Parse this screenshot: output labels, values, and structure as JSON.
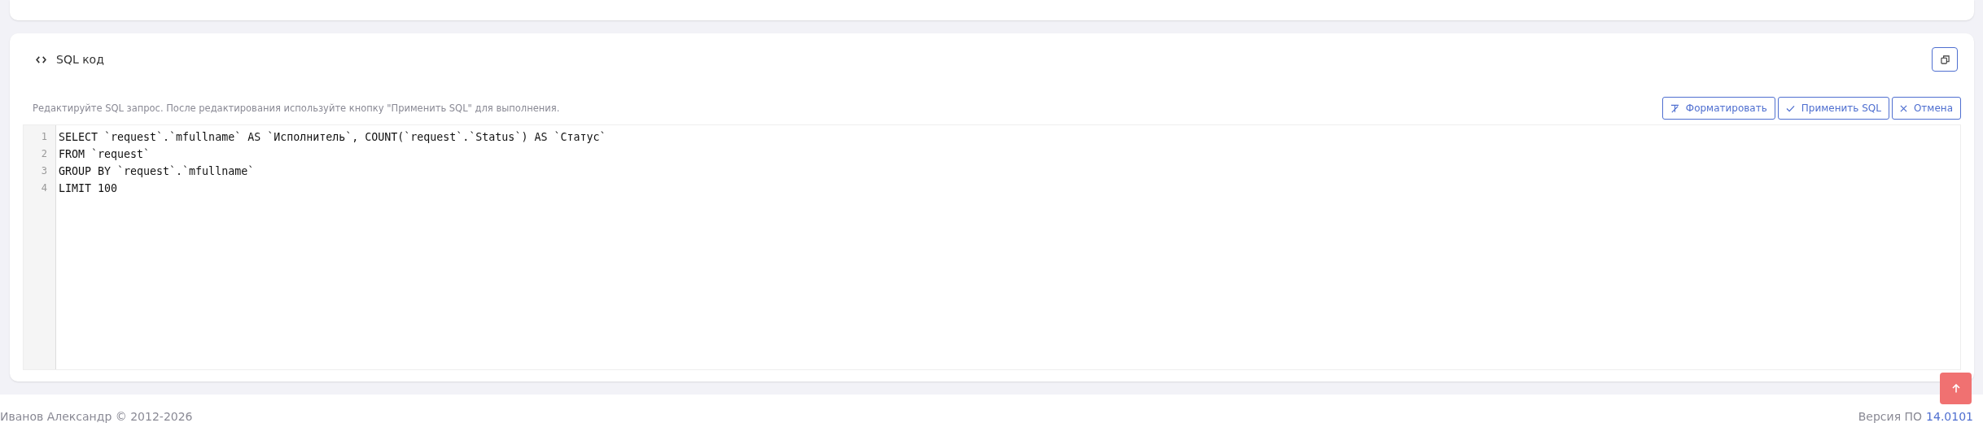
{
  "card": {
    "title": "SQL код",
    "hint": "Редактируйте SQL запрос. После редактирования используйте кнопку \"Применить SQL\" для выполнения.",
    "buttons": [
      {
        "kind": "format",
        "label": "Форматировать"
      },
      {
        "kind": "apply",
        "label": "Применить SQL"
      },
      {
        "kind": "cancel",
        "label": "Отмена"
      }
    ],
    "editor": {
      "lines": [
        {
          "number": "1",
          "code": "SELECT `request`.`mfullname` AS `Исполнитель`, COUNT(`request`.`Status`) AS `Статус`"
        },
        {
          "number": "2",
          "code": "FROM `request`"
        },
        {
          "number": "3",
          "code": "GROUP BY `request`.`mfullname`"
        },
        {
          "number": "4",
          "code": "LIMIT 100"
        }
      ]
    }
  },
  "footer": {
    "copyright": "Иванов Александр © 2012-2026",
    "version_label": "Версия ПО",
    "version": "14.0101"
  }
}
